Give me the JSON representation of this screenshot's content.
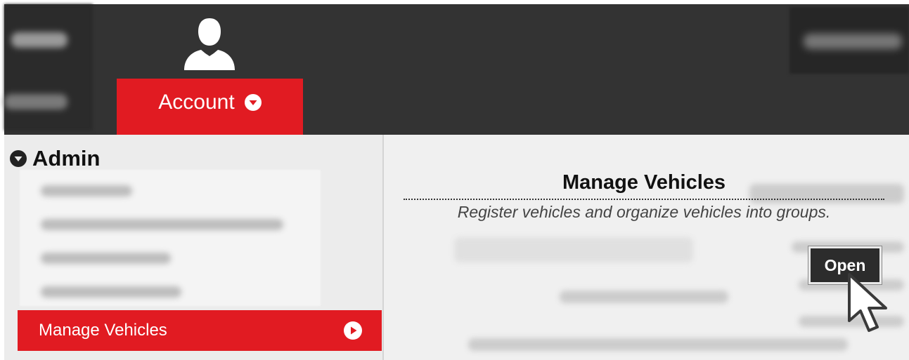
{
  "header": {
    "account_tab_label": "Account",
    "user_icon": "user-silhouette-icon"
  },
  "sidebar": {
    "section_title": "Admin",
    "active_item_label": "Manage Vehicles"
  },
  "tooltip": {
    "title": "Manage Vehicles",
    "description": "Register vehicles and organize vehicles into groups.",
    "open_button_label": "Open"
  },
  "colors": {
    "header_bg": "#333333",
    "accent_red": "#e11b22",
    "panel_bg": "#ececec"
  }
}
